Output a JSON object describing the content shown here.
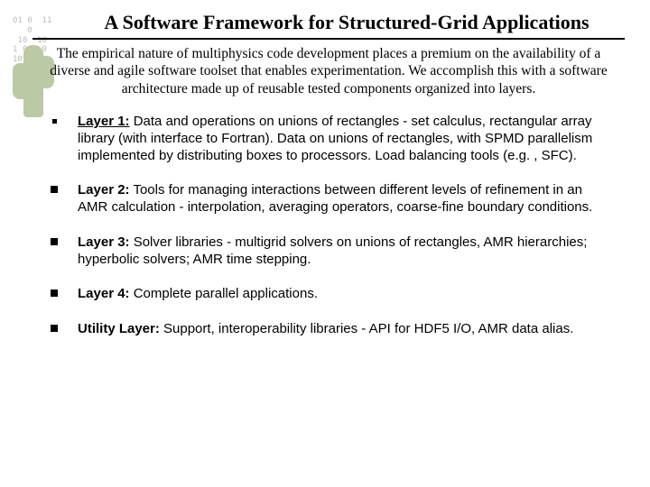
{
  "title": "A Software Framework for Structured-Grid Applications",
  "intro": "The empirical nature of multiphysics code development places a premium on the availability of a diverse and agile software toolset that enables experimentation. We accomplish this with a software architecture made up of reusable tested components organized into layers.",
  "layers": [
    {
      "label": "Layer 1:",
      "text": " Data and operations on unions of rectangles - set calculus, rectangular array library (with interface to Fortran). Data on unions of rectangles, with SPMD parallelism implemented by distributing boxes to processors. Load balancing tools (e.g. , SFC)."
    },
    {
      "label": "Layer 2:",
      "text": " Tools for managing interactions between different levels of refinement in an AMR calculation - interpolation, averaging operators, coarse-fine boundary conditions."
    },
    {
      "label": "Layer 3:",
      "text": " Solver libraries - multigrid solvers on unions of rectangles, AMR hierarchies; hyperbolic solvers;  AMR time stepping."
    },
    {
      "label": "Layer 4:",
      "text": " Complete parallel applications."
    },
    {
      "label": "Utility Layer:",
      "text": " Support, interoperability libraries - API for HDF5 I/O, AMR data alias."
    }
  ],
  "bg_digits": "01 0  11\n   0\n 10  10\n1 0 1 0\n10 01 0\n10 10\n 01"
}
